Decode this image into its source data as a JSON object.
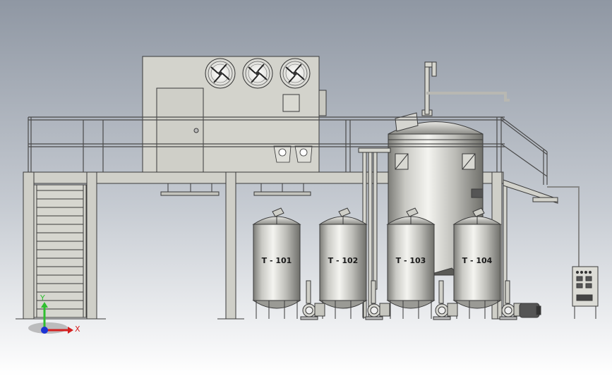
{
  "tanks": [
    {
      "label": "T - 101"
    },
    {
      "label": "T - 102"
    },
    {
      "label": "T - 103"
    },
    {
      "label": "T - 104"
    }
  ],
  "axes": {
    "x_label": "X",
    "y_label": "Y"
  },
  "colors": {
    "background_top": "#8f97a3",
    "background_bottom": "#ffffff",
    "structure": "#d3d3cc",
    "outline": "#3a3a3a",
    "x_axis": "#d42020",
    "y_axis": "#2fbf2f",
    "origin": "#1c33d4"
  }
}
